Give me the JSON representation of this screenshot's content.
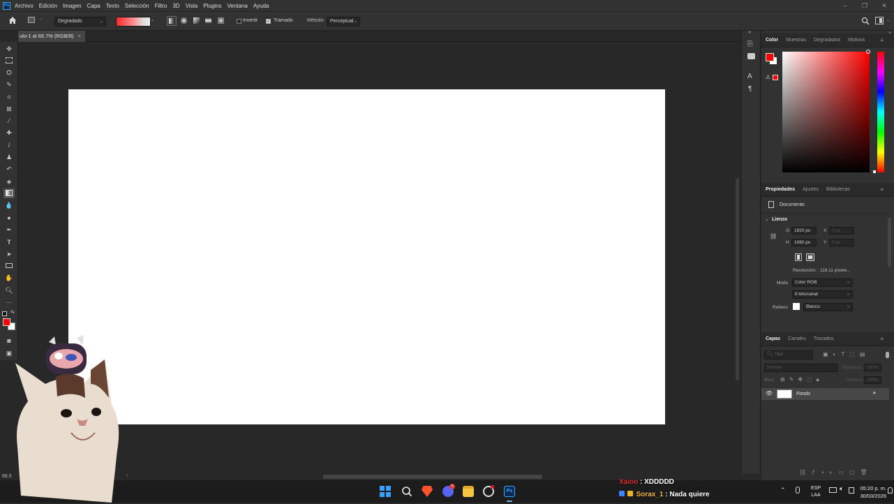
{
  "menu": {
    "items": [
      "Archivo",
      "Edición",
      "Imagen",
      "Capa",
      "Texto",
      "Selección",
      "Filtro",
      "3D",
      "Vista",
      "Plugins",
      "Ventana",
      "Ayuda"
    ]
  },
  "options": {
    "preset": "Degradado",
    "invert_label": "Invertir",
    "dither_label": "Tramado",
    "method_label": "Método:",
    "method_value": "Perceptual",
    "invert_checked": false,
    "dither_checked": true
  },
  "document": {
    "tab_label": "ulo-1 al 66.7% (RGB/8)",
    "close": "×",
    "zoom": "66.6"
  },
  "color_panel": {
    "tabs": [
      "Color",
      "Muestras",
      "Degradados",
      "Motivos"
    ],
    "foreground": "#ff0000",
    "background": "#ffffff"
  },
  "properties_panel": {
    "tabs": [
      "Propiedades",
      "Ajustes",
      "Bibliotecas"
    ],
    "doc_label": "Documento",
    "section": "Lienzo",
    "w_label": "O",
    "w_value": "1920 px",
    "h_label": "H",
    "h_value": "1080 px",
    "x_label": "X",
    "x_value": "0 px",
    "y_label": "Y",
    "y_value": "0 px",
    "resolution_label": "Resolución:",
    "resolution_value": "118.11 píxele...",
    "mode_label": "Modo",
    "mode_value": "Color RGB",
    "bits_value": "8 bits/canal",
    "fill_label": "Relleno",
    "fill_value": "Blanco"
  },
  "layers_panel": {
    "tabs": [
      "Capas",
      "Canales",
      "Trazados"
    ],
    "search_placeholder": "Tipo",
    "blend_mode": "Normal",
    "opacity_label": "Opacidad:",
    "opacity_value": "100%",
    "lock_label": "Bloq.:",
    "fill_label": "Relleno:",
    "fill_value": "100%",
    "layers": [
      {
        "name": "Fondo",
        "visible": true,
        "locked": true
      }
    ]
  },
  "chat": {
    "line1_user": "Xaioo",
    "line1_msg": ": XDDDDD",
    "line2_user": "Sorax_1",
    "line2_msg": ": Nada quiere"
  },
  "taskbar": {
    "lang": "ESP",
    "region": "LAA",
    "time": "05:20 p. m.",
    "date": "30/03/2026",
    "discord_badge": "+"
  }
}
